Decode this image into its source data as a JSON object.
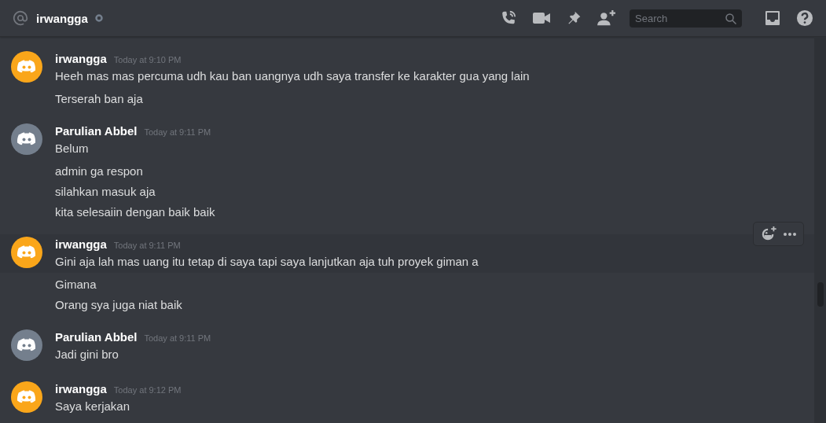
{
  "header": {
    "title": "irwangga",
    "search": {
      "placeholder": "Search"
    }
  },
  "groups": [
    {
      "author": "irwangga",
      "timestamp": "Today at 9:10 PM",
      "color": "#faa61a",
      "highlighted": false,
      "messages": [
        "Heeh mas mas percuma udh kau ban uangnya udh saya transfer ke karakter gua yang lain",
        "Terserah ban aja"
      ]
    },
    {
      "author": "Parulian Abbel",
      "timestamp": "Today at 9:11 PM",
      "color": "#747f8d",
      "highlighted": false,
      "messages": [
        "Belum",
        "admin ga respon",
        "silahkan masuk aja",
        "kita selesaiin dengan baik baik"
      ]
    },
    {
      "author": "irwangga",
      "timestamp": "Today at 9:11 PM",
      "color": "#faa61a",
      "highlighted": true,
      "messages": [
        "Gini aja lah mas uang itu tetap di saya tapi saya lanjutkan aja tuh proyek giman a",
        "Gimana",
        "Orang sya juga niat baik"
      ]
    },
    {
      "author": "Parulian Abbel",
      "timestamp": "Today at 9:11 PM",
      "color": "#747f8d",
      "highlighted": false,
      "messages": [
        "Jadi gini bro"
      ]
    },
    {
      "author": "irwangga",
      "timestamp": "Today at 9:12 PM",
      "color": "#faa61a",
      "highlighted": false,
      "messages": [
        "Saya kerjakan"
      ]
    }
  ]
}
